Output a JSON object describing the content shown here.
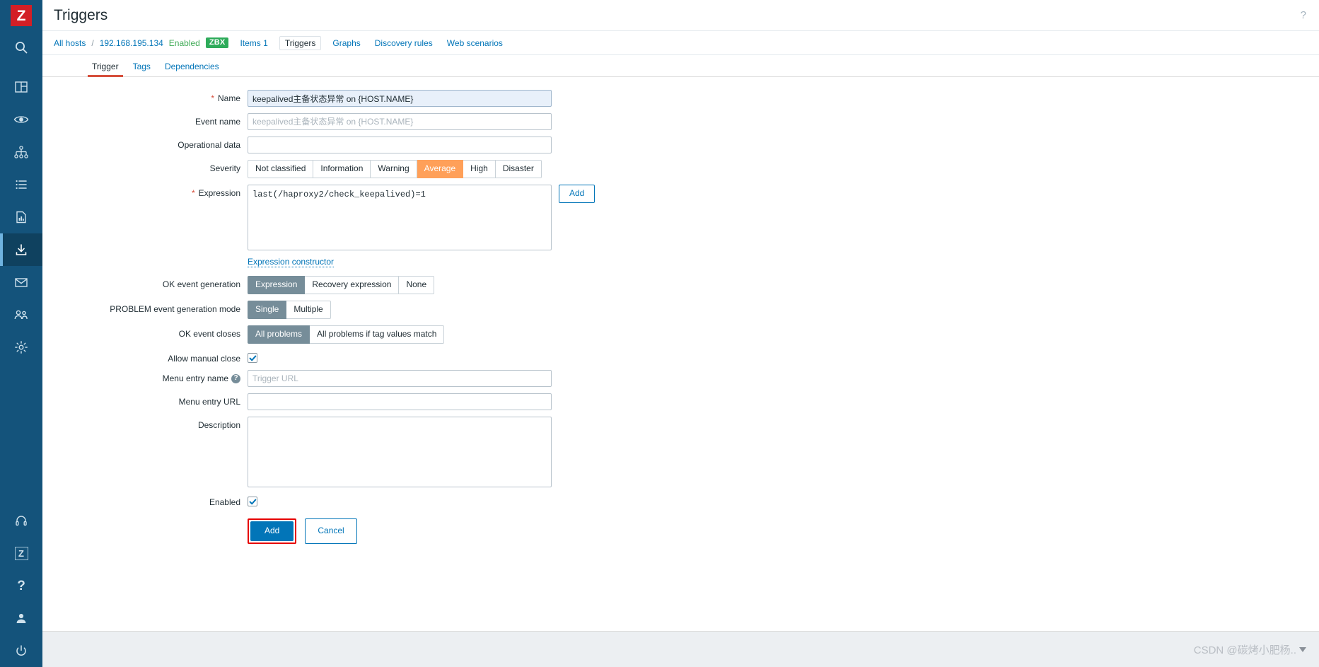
{
  "sidebar": {
    "logo_letter": "Z",
    "items": [
      {
        "name": "search-icon",
        "label": "Search"
      },
      {
        "name": "dashboard-icon",
        "label": "Dashboards"
      },
      {
        "name": "eye-monitoring-icon",
        "label": "Monitoring"
      },
      {
        "name": "services-tree-icon",
        "label": "Services"
      },
      {
        "name": "list-inventory-icon",
        "label": "Inventory"
      },
      {
        "name": "reports-chart-icon",
        "label": "Reports"
      },
      {
        "name": "data-collection-icon",
        "label": "Data collection",
        "active": true
      },
      {
        "name": "alerts-mail-icon",
        "label": "Alerts"
      },
      {
        "name": "users-icon",
        "label": "Users"
      },
      {
        "name": "gear-icon",
        "label": "Administration"
      }
    ],
    "bottom_items": [
      {
        "name": "support-headset-icon",
        "label": "Support"
      },
      {
        "name": "zabbix-share-icon",
        "label": "Z"
      },
      {
        "name": "help-question-icon",
        "label": "?"
      },
      {
        "name": "user-profile-icon",
        "label": "User settings"
      },
      {
        "name": "power-signout-icon",
        "label": "Sign out"
      }
    ]
  },
  "header": {
    "title": "Triggers",
    "help_icon": "?"
  },
  "breadcrumb": {
    "all_hosts": "All hosts",
    "separator": "/",
    "host": "192.168.195.134",
    "status": "Enabled",
    "badge": "ZBX",
    "tabs": [
      {
        "label": "Items 1",
        "selected": false
      },
      {
        "label": "Triggers",
        "selected": true
      },
      {
        "label": "Graphs",
        "selected": false
      },
      {
        "label": "Discovery rules",
        "selected": false
      },
      {
        "label": "Web scenarios",
        "selected": false
      }
    ]
  },
  "tabstrip": [
    {
      "label": "Trigger",
      "active": true
    },
    {
      "label": "Tags",
      "active": false
    },
    {
      "label": "Dependencies",
      "active": false
    }
  ],
  "form": {
    "name": {
      "label": "Name",
      "required": true,
      "value": "keepalived主备状态异常 on {HOST.NAME}"
    },
    "event_name": {
      "label": "Event name",
      "value": "",
      "placeholder": "keepalived主备状态异常 on {HOST.NAME}"
    },
    "operational_data": {
      "label": "Operational data",
      "value": "",
      "placeholder": ""
    },
    "severity": {
      "label": "Severity",
      "options": [
        "Not classified",
        "Information",
        "Warning",
        "Average",
        "High",
        "Disaster"
      ],
      "selected": "Average",
      "selected_color": "#ffa059"
    },
    "expression": {
      "label": "Expression",
      "required": true,
      "value": "last(/haproxy2/check_keepalived)=1",
      "add_button": "Add",
      "constructor_link": "Expression constructor"
    },
    "ok_event_generation": {
      "label": "OK event generation",
      "options": [
        "Expression",
        "Recovery expression",
        "None"
      ],
      "selected": "Expression"
    },
    "problem_event_generation_mode": {
      "label": "PROBLEM event generation mode",
      "options": [
        "Single",
        "Multiple"
      ],
      "selected": "Single"
    },
    "ok_event_closes": {
      "label": "OK event closes",
      "options": [
        "All problems",
        "All problems if tag values match"
      ],
      "selected": "All problems"
    },
    "allow_manual_close": {
      "label": "Allow manual close",
      "checked": true
    },
    "menu_entry_name": {
      "label": "Menu entry name",
      "help": "?",
      "value": "",
      "placeholder": "Trigger URL"
    },
    "menu_entry_url": {
      "label": "Menu entry URL",
      "value": "",
      "placeholder": ""
    },
    "description": {
      "label": "Description",
      "value": "",
      "placeholder": ""
    },
    "enabled": {
      "label": "Enabled",
      "checked": true
    },
    "submit_button": "Add",
    "cancel_button": "Cancel"
  },
  "footer": {
    "watermark": "CSDN @碳烤小肥杨.."
  },
  "colors": {
    "sidebar_bg": "#14537b",
    "accent_blue": "#0275b8",
    "severity_average": "#ffa059",
    "selected_gray": "#768d99",
    "zbx_green": "#2eab5a",
    "highlight_red": "#e60000"
  }
}
